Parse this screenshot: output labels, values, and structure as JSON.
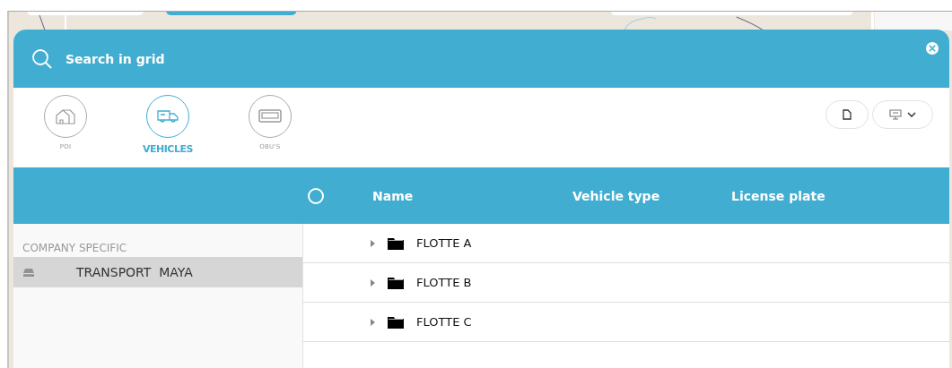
{
  "search": {
    "placeholder": "Search in grid"
  },
  "categories": [
    {
      "label": "POI",
      "kind": "building",
      "selected": false
    },
    {
      "label": "VEHICLES",
      "kind": "truck",
      "selected": true
    },
    {
      "label": "OBU'S",
      "kind": "device",
      "selected": false
    }
  ],
  "sidebar": {
    "heading": "COMPANY SPECIFIC",
    "items": [
      {
        "label": "TRANSPORT  MAYA",
        "selected": true
      }
    ]
  },
  "table": {
    "select_all": {
      "checked": false
    },
    "columns": [
      "Name",
      "Vehicle type",
      "License plate"
    ],
    "rows": [
      {
        "name": "FLOTTE A",
        "expanded": false
      },
      {
        "name": "FLOTTE B",
        "expanded": false
      },
      {
        "name": "FLOTTE C",
        "expanded": false
      }
    ]
  }
}
